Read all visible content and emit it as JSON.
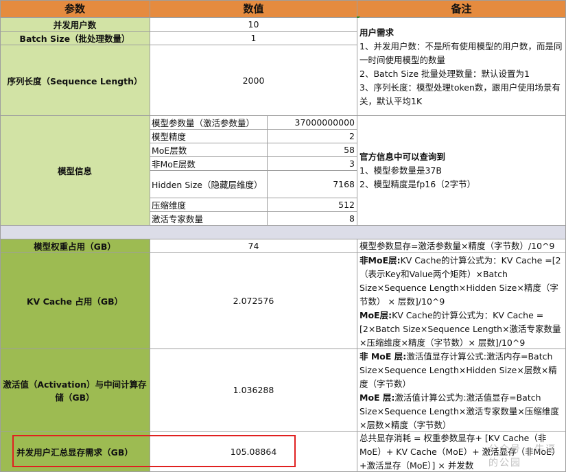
{
  "header": {
    "param": "参数",
    "value": "数值",
    "note": "备注"
  },
  "concurrent_users": {
    "label": "并发用户数",
    "value": "10"
  },
  "batch_size": {
    "label": "Batch Size（批处理数量）",
    "value": "1"
  },
  "sequence_length": {
    "label": "序列长度（Sequence Length）",
    "value": "2000"
  },
  "user_needs_note": {
    "title": "用户需求",
    "lines": [
      "1、并发用户数：不是所有使用模型的用户数，而是同一时间使用模型的数量",
      "2、Batch Size 批量处理数量：默认设置为1",
      "3、序列长度：模型处理token数，跟用户使用场景有关，默认平均1K"
    ]
  },
  "model_info": {
    "label": "模型信息",
    "rows": [
      {
        "name": "模型参数量（激活参数量）",
        "value": "37000000000"
      },
      {
        "name": "模型精度",
        "value": "2"
      },
      {
        "name": "MoE层数",
        "value": "58"
      },
      {
        "name": "非MoE层数",
        "value": "3"
      },
      {
        "name": "Hidden Size（隐藏层维度）",
        "value": "7168"
      },
      {
        "name": "压缩维度",
        "value": "512"
      },
      {
        "name": "激活专家数量",
        "value": "8"
      }
    ],
    "note": {
      "title": "官方信息中可以查询到",
      "lines": [
        "1、模型参数量是37B",
        "2、模型精度是fp16（2字节）"
      ]
    }
  },
  "weights": {
    "label": "模型权重占用（GB）",
    "value": "74",
    "note": "模型参数显存=激活参数量×精度（字节数）/10^9"
  },
  "kv_cache": {
    "label": "KV Cache 占用（GB）",
    "value": "2.072576",
    "note1_bold": "非MoE层:",
    "note1_text": "KV Cache的计算公式为：KV Cache =[2（表示Key和Value两个矩阵）×Batch Size×Sequence Length×Hidden Size×精度（字节数） × 层数]/10^9",
    "note2_bold": "MoE层:",
    "note2_text": "KV Cache的计算公式为：KV Cache =[2×Batch Size×Sequence Length×激活专家数量×压缩维度×精度（字节数）× 层数]/10^9"
  },
  "activation": {
    "label": "激活值（Activation）与中间计算存储（GB）",
    "value": "1.036288",
    "note1_bold": "非 MoE 层:",
    "note1_text": "激活值显存计算公式:激活内存=Batch Size×Sequence Length×Hidden Size×层数×精度（字节数）",
    "note2_bold": "MoE 层:",
    "note2_text": "激活值计算公式为:激活值显存=Batch Size×Sequence Length×激活专家数量×压缩维度×层数×精度（字节数）"
  },
  "total": {
    "label": "并发用户汇总显存需求（GB）",
    "value": "105.08864",
    "note": "总共显存消耗 = 权重参数显存+ [KV Cache（非MoE）+ KV Cache（MoE）+ 激活显存（非MoE）+激活显存（MoE）] × 并发数"
  },
  "watermark": "公众号 · 牛逼的公园",
  "colors": {
    "header": "#e58b3f",
    "light_green": "#d2e3a5",
    "dark_green": "#9dbb52",
    "highlight": "#e02020"
  }
}
